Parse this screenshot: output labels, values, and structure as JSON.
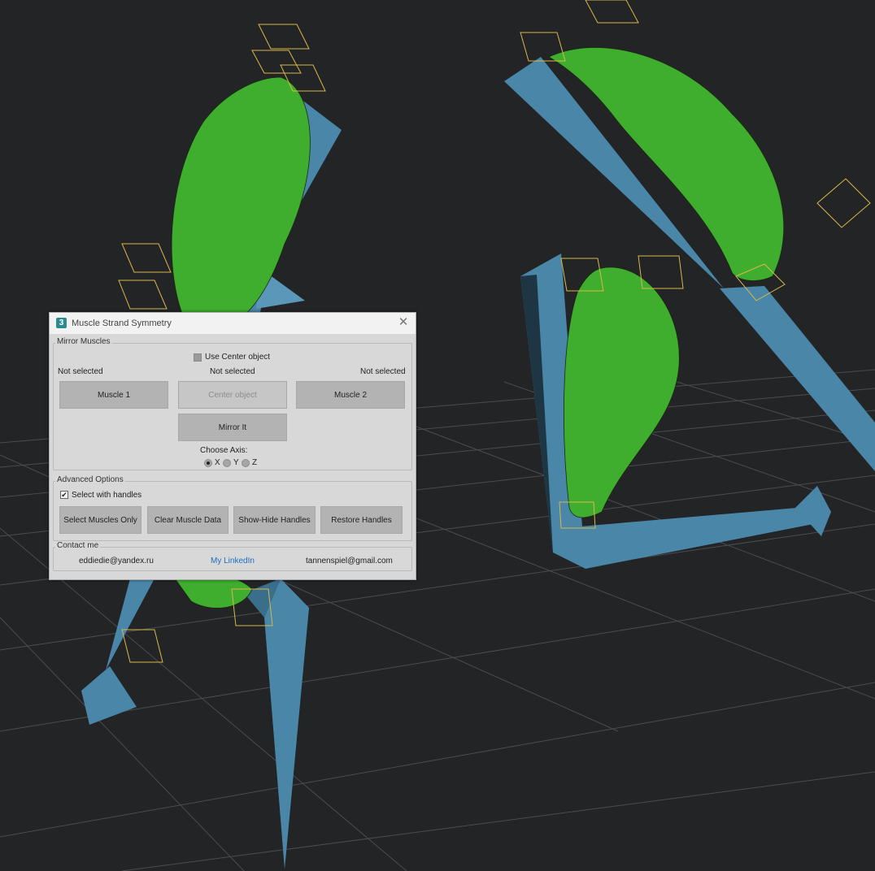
{
  "window": {
    "title": "Muscle Strand Symmetry",
    "app_icon_glyph": "3",
    "close_glyph": "✕"
  },
  "mirror_muscles": {
    "group_label": "Mirror Muscles",
    "use_center_object_label": "Use Center object",
    "use_center_object_checked": false,
    "muscle1_status": "Not selected",
    "center_status": "Not selected",
    "muscle2_status": "Not selected",
    "muscle1_button": "Muscle 1",
    "center_object_button": "Center object",
    "muscle2_button": "Muscle 2",
    "mirror_button": "Mirror It",
    "choose_axis_label": "Choose Axis:",
    "axis_options": [
      "X",
      "Y",
      "Z"
    ],
    "axis_selected": "X"
  },
  "advanced_options": {
    "group_label": "Advanced Options",
    "select_with_handles_label": "Select with handles",
    "select_with_handles_checked": true,
    "buttons": [
      "Select Muscles Only",
      "Clear Muscle Data",
      "Show-Hide Handles",
      "Restore Handles"
    ]
  },
  "contact": {
    "group_label": "Contact me",
    "email1": "eddiedie@yandex.ru",
    "linkedin": "My LinkedIn",
    "email2": "tannenspiel@gmail.com"
  },
  "colors": {
    "viewport_bg": "#222426",
    "grid_line": "#4a4c4e",
    "muscle_green": "#3fae2f",
    "bone_blue": "#4a86a8",
    "handle_yellow": "#d8b84a"
  }
}
